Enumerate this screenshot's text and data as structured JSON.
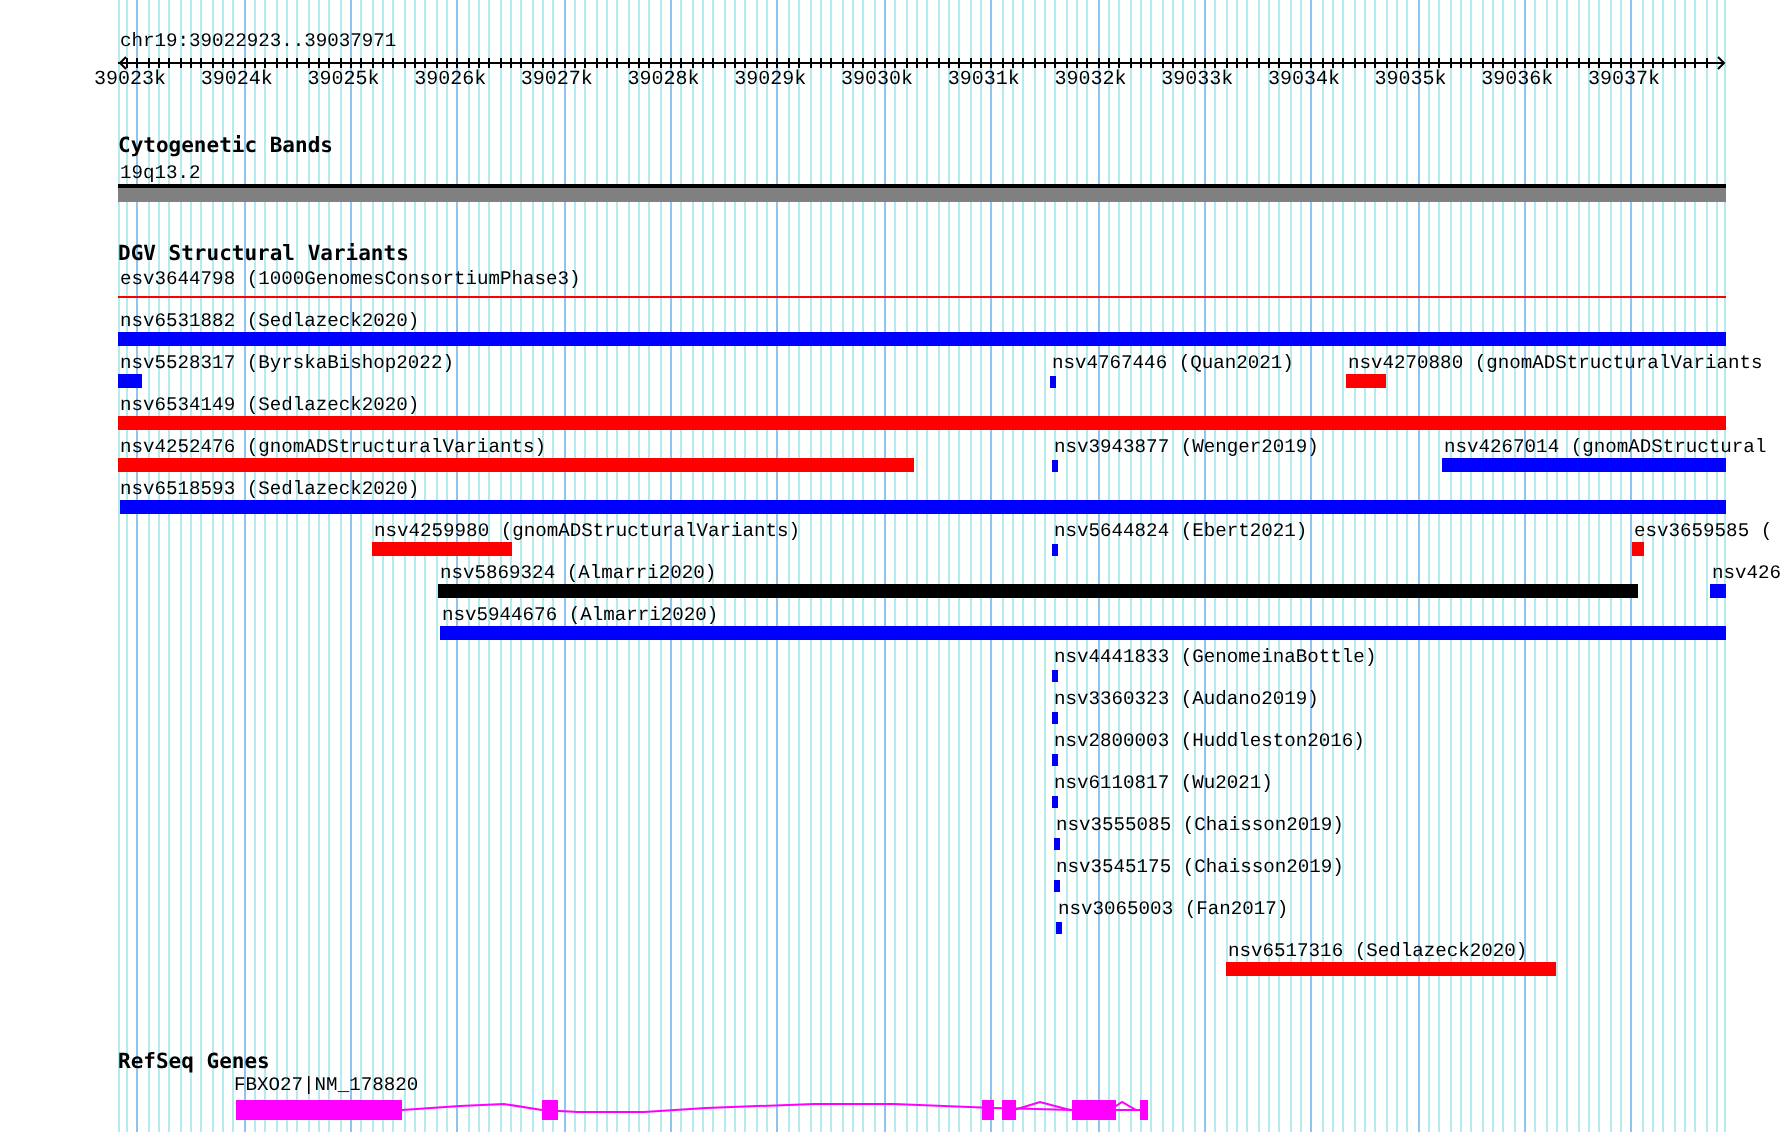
{
  "ruler": {
    "location": "chr19:39022923..39037971",
    "ticks": [
      "39023k",
      "39024k",
      "39025k",
      "39026k",
      "39027k",
      "39028k",
      "39029k",
      "39030k",
      "39031k",
      "39032k",
      "39033k",
      "39034k",
      "39035k",
      "39036k",
      "39037k"
    ]
  },
  "tracks": [
    {
      "kind": "bands",
      "title": "Cytogenetic Bands",
      "features": [
        {
          "label": "19q13.2"
        }
      ]
    },
    {
      "kind": "variants",
      "title": "DGV Structural Variants",
      "features": [
        {
          "label": "esv3644798 (1000GenomesConsortiumPhase3)",
          "color": "#ff0000"
        },
        {
          "label": "nsv6531882 (Sedlazeck2020)",
          "color": "#0000ff"
        },
        {
          "label": "nsv5528317 (ByrskaBishop2022)",
          "color": "#0000ff"
        },
        {
          "label": "nsv4767446 (Quan2021)",
          "color": "#0000ff"
        },
        {
          "label": "nsv4270880 (gnomADStructuralVariants",
          "color": "#ff0000"
        },
        {
          "label": "nsv6534149 (Sedlazeck2020)",
          "color": "#ff0000"
        },
        {
          "label": "nsv4252476 (gnomADStructuralVariants)",
          "color": "#ff0000"
        },
        {
          "label": "nsv3943877 (Wenger2019)",
          "color": "#0000ff"
        },
        {
          "label": "nsv4267014 (gnomADStructural",
          "color": "#0000ff"
        },
        {
          "label": "nsv6518593 (Sedlazeck2020)",
          "color": "#0000ff"
        },
        {
          "label": "nsv4259980 (gnomADStructuralVariants)",
          "color": "#ff0000"
        },
        {
          "label": "nsv5644824 (Ebert2021)",
          "color": "#0000ff"
        },
        {
          "label": "esv3659585 (",
          "color": "#ff0000"
        },
        {
          "label": "nsv5869324 (Almarri2020)",
          "color": "#000000"
        },
        {
          "label": "nsv426",
          "color": "#0000ff"
        },
        {
          "label": "nsv5944676 (Almarri2020)",
          "color": "#0000ff"
        },
        {
          "label": "nsv4441833 (GenomeinaBottle)",
          "color": "#0000ff"
        },
        {
          "label": "nsv3360323 (Audano2019)",
          "color": "#0000ff"
        },
        {
          "label": "nsv2800003 (Huddleston2016)",
          "color": "#0000ff"
        },
        {
          "label": "nsv6110817 (Wu2021)",
          "color": "#0000ff"
        },
        {
          "label": "nsv3555085 (Chaisson2019)",
          "color": "#0000ff"
        },
        {
          "label": "nsv3545175 (Chaisson2019)",
          "color": "#0000ff"
        },
        {
          "label": "nsv3065003 (Fan2017)",
          "color": "#0000ff"
        },
        {
          "label": "nsv6517316 (Sedlazeck2020)",
          "color": "#ff0000"
        }
      ]
    },
    {
      "kind": "genes",
      "title": "RefSeq Genes",
      "features": [
        {
          "label": "FBXO27|NM_178820"
        }
      ]
    }
  ]
}
